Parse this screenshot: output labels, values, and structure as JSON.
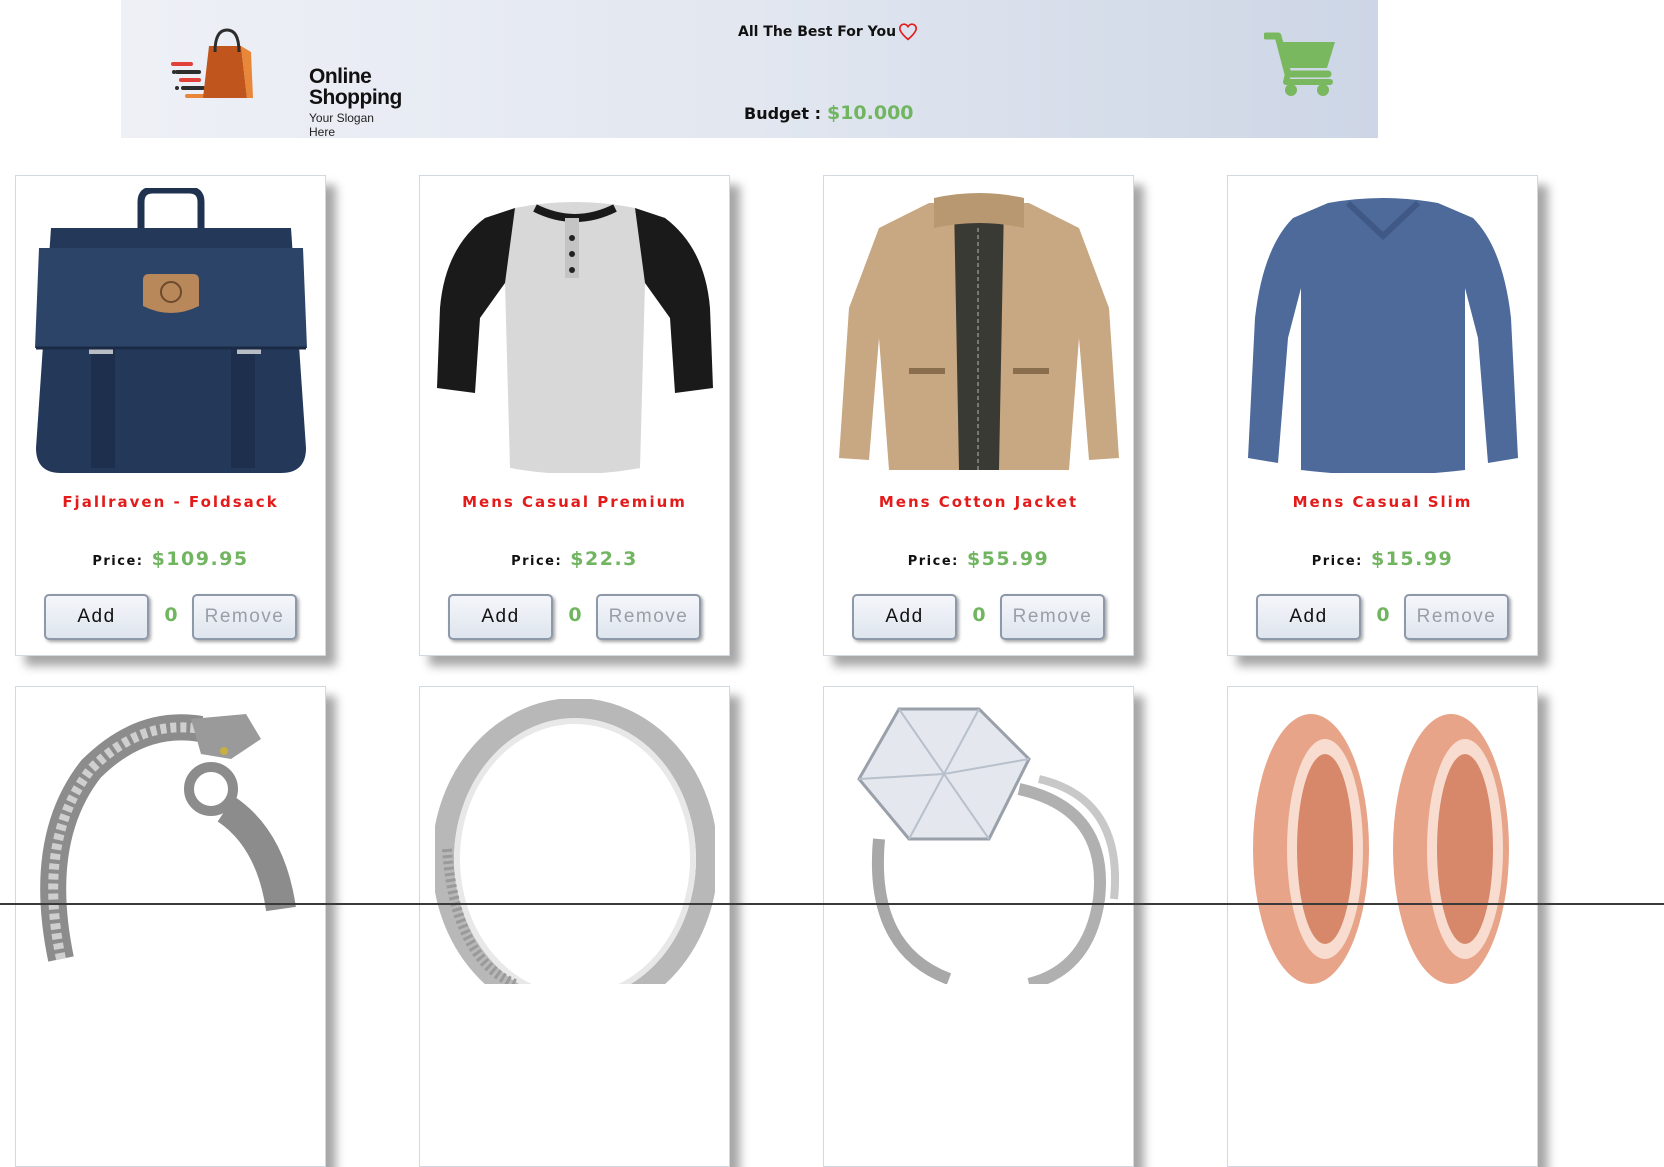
{
  "header": {
    "logo": {
      "title_line1": "Online",
      "title_line2": "Shopping",
      "slogan": "Your Slogan Here"
    },
    "tagline": "All The Best For You",
    "tagline_icon": "heart-outline-icon",
    "budget_label": "Budget :",
    "budget_value": "$10.000",
    "cart_icon": "shopping-cart-icon"
  },
  "colors": {
    "title_red": "#e41b1b",
    "price_green": "#71b561",
    "cart_green": "#7ab85f",
    "heart_red": "#e21b1b"
  },
  "products": [
    {
      "title": "Fjallraven - Foldsack",
      "price_label": "Price:",
      "price": "$109.95",
      "add_label": "Add",
      "quantity": "0",
      "remove_label": "Remove",
      "image": "backpack"
    },
    {
      "title": "Mens Casual Premium",
      "price_label": "Price:",
      "price": "$22.3",
      "add_label": "Add",
      "quantity": "0",
      "remove_label": "Remove",
      "image": "raglan-tshirt"
    },
    {
      "title": "Mens Cotton Jacket",
      "price_label": "Price:",
      "price": "$55.99",
      "add_label": "Add",
      "quantity": "0",
      "remove_label": "Remove",
      "image": "jacket"
    },
    {
      "title": "Mens Casual Slim",
      "price_label": "Price:",
      "price": "$15.99",
      "add_label": "Add",
      "quantity": "0",
      "remove_label": "Remove",
      "image": "longsleeve-shirt"
    },
    {
      "image": "dragon-bracelet"
    },
    {
      "image": "silver-ring"
    },
    {
      "image": "diamond-ring"
    },
    {
      "image": "rose-gold-plugs"
    }
  ]
}
